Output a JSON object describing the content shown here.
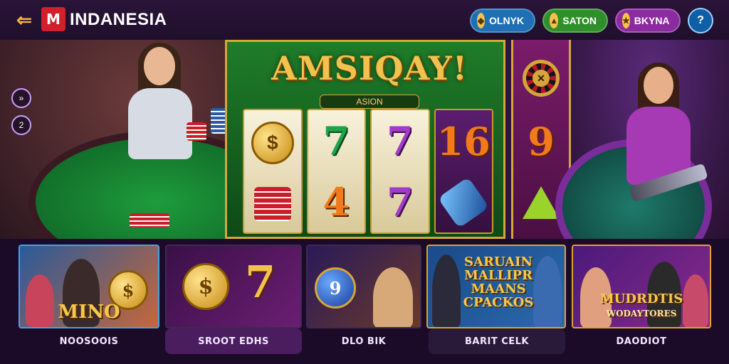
{
  "header": {
    "logo_text": "M",
    "brand": "INDANESIA",
    "buttons": [
      {
        "label": "OLNYK",
        "color": "#1f6fb4"
      },
      {
        "label": "SATON",
        "color": "#2f8f2a"
      },
      {
        "label": "BKYNA",
        "color": "#8c2aa0"
      }
    ],
    "help": "?"
  },
  "hero": {
    "side_buttons": [
      "»",
      "2"
    ],
    "slot": {
      "title": "AMSIQAY!",
      "subtitle": "ASION",
      "reels": [
        [
          "coin",
          "stack"
        ],
        [
          "7",
          "4"
        ],
        [
          "7",
          "7"
        ],
        [
          "16",
          "potion"
        ]
      ],
      "side_reel": [
        "roulette",
        "9",
        "triangle"
      ]
    }
  },
  "cards": [
    {
      "title": "MINO",
      "label": "NOOSOOIS"
    },
    {
      "title": "$",
      "label": "SROOT EDHS"
    },
    {
      "title": "9",
      "label": "DLO BIK"
    },
    {
      "title": "SARUAIN MALLIPR MAANS CPACKOS",
      "label": "BARIT CELK"
    },
    {
      "title": "MUDRDTIS",
      "subtitle": "WODAYTORES",
      "label": "DAODIOT"
    }
  ]
}
